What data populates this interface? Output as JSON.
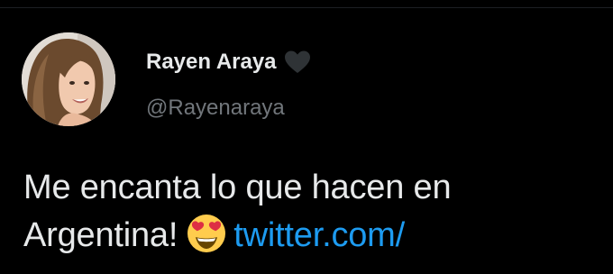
{
  "tweet": {
    "author": {
      "display_name": "Rayen Araya",
      "handle": "@Rayenaraya"
    },
    "text_line1": "Me encanta lo que hacen en",
    "text_line2_start": "Argentina!",
    "link_text": "twitter.com/",
    "icons": {
      "badge": "black-heart-icon",
      "emoji": "heart-eyes-emoji-icon"
    }
  },
  "colors": {
    "background": "#000000",
    "text_primary": "#e7e9ea",
    "text_secondary": "#71767b",
    "link": "#1d9bf0"
  }
}
